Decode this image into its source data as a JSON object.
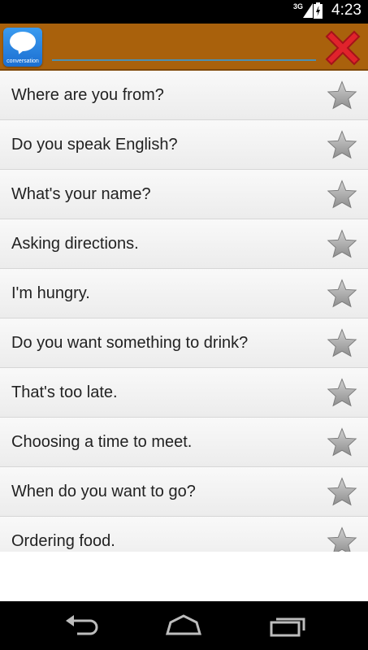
{
  "status_bar": {
    "network": "3G",
    "time": "4:23"
  },
  "app": {
    "icon_label": "conversation"
  },
  "search": {
    "value": "",
    "placeholder": ""
  },
  "phrases": [
    "Where are you from?",
    "Do you speak English?",
    "What's your name?",
    "Asking directions.",
    "I'm hungry.",
    "Do you want something to drink?",
    "That's too late.",
    "Choosing a time to meet.",
    "When do you want to go?",
    "Ordering food."
  ],
  "colors": {
    "action_bar": "#a9610c",
    "close_icon": "#e0232c",
    "star": "#a8a8a8"
  },
  "icons": {
    "close": "close-icon",
    "favorite": "star-icon",
    "back": "back-icon",
    "home": "home-icon",
    "recents": "recents-icon"
  }
}
